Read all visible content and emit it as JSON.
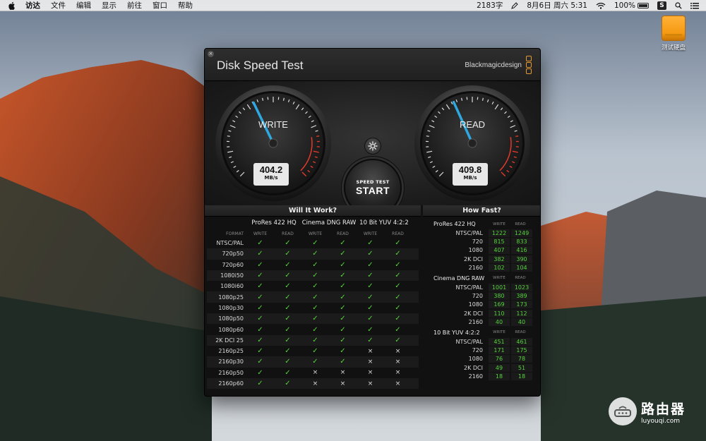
{
  "menubar": {
    "items": [
      "访达",
      "文件",
      "编辑",
      "显示",
      "前往",
      "窗口",
      "帮助"
    ],
    "word_count": "2183字",
    "datetime": "8月6日 周六  5:31",
    "battery": "100%",
    "s_badge": "S"
  },
  "desktop": {
    "disk_label": "测试硬盘"
  },
  "app": {
    "title": "Disk Speed Test",
    "brand": "Blackmagicdesign",
    "close_glyph": "×",
    "write": {
      "label": "WRITE",
      "value": "404.2",
      "unit": "MB/s",
      "level": 404.2
    },
    "read": {
      "label": "READ",
      "value": "409.8",
      "unit": "MB/s",
      "level": 409.8
    },
    "start": {
      "sub": "SPEED TEST",
      "main": "START"
    },
    "accent_color": "#2fa8e0",
    "ok_color": "#54d43a"
  },
  "will_it_work": {
    "title": "Will It Work?",
    "groups": [
      "ProRes 422 HQ",
      "Cinema DNG RAW",
      "10 Bit YUV 4:2:2"
    ],
    "format_label": "FORMAT",
    "write_label": "WRITE",
    "read_label": "READ",
    "check": "✓",
    "cross": "×",
    "rows": [
      {
        "fmt": "NTSC/PAL",
        "v": [
          1,
          1,
          1,
          1,
          1,
          1
        ]
      },
      {
        "fmt": "720p50",
        "v": [
          1,
          1,
          1,
          1,
          1,
          1
        ]
      },
      {
        "fmt": "720p60",
        "v": [
          1,
          1,
          1,
          1,
          1,
          1
        ]
      },
      {
        "fmt": "1080i50",
        "v": [
          1,
          1,
          1,
          1,
          1,
          1
        ]
      },
      {
        "fmt": "1080i60",
        "v": [
          1,
          1,
          1,
          1,
          1,
          1
        ]
      },
      {
        "fmt": "1080p25",
        "v": [
          1,
          1,
          1,
          1,
          1,
          1
        ]
      },
      {
        "fmt": "1080p30",
        "v": [
          1,
          1,
          1,
          1,
          1,
          1
        ]
      },
      {
        "fmt": "1080p50",
        "v": [
          1,
          1,
          1,
          1,
          1,
          1
        ]
      },
      {
        "fmt": "1080p60",
        "v": [
          1,
          1,
          1,
          1,
          1,
          1
        ]
      },
      {
        "fmt": "2K DCI 25",
        "v": [
          1,
          1,
          1,
          1,
          1,
          1
        ]
      },
      {
        "fmt": "2160p25",
        "v": [
          1,
          1,
          1,
          1,
          0,
          0
        ]
      },
      {
        "fmt": "2160p30",
        "v": [
          1,
          1,
          1,
          1,
          0,
          0
        ]
      },
      {
        "fmt": "2160p50",
        "v": [
          1,
          1,
          0,
          0,
          0,
          0
        ]
      },
      {
        "fmt": "2160p60",
        "v": [
          1,
          1,
          0,
          0,
          0,
          0
        ]
      }
    ]
  },
  "how_fast": {
    "title": "How Fast?",
    "write_label": "WRITE",
    "read_label": "READ",
    "groups": [
      {
        "name": "ProRes 422 HQ",
        "rows": [
          {
            "fmt": "NTSC/PAL",
            "w": "1222",
            "r": "1249"
          },
          {
            "fmt": "720",
            "w": "815",
            "r": "833"
          },
          {
            "fmt": "1080",
            "w": "407",
            "r": "416"
          },
          {
            "fmt": "2K DCI",
            "w": "382",
            "r": "390"
          },
          {
            "fmt": "2160",
            "w": "102",
            "r": "104"
          }
        ]
      },
      {
        "name": "Cinema DNG RAW",
        "rows": [
          {
            "fmt": "NTSC/PAL",
            "w": "1001",
            "r": "1023"
          },
          {
            "fmt": "720",
            "w": "380",
            "r": "389"
          },
          {
            "fmt": "1080",
            "w": "169",
            "r": "173"
          },
          {
            "fmt": "2K DCI",
            "w": "110",
            "r": "112"
          },
          {
            "fmt": "2160",
            "w": "40",
            "r": "40"
          }
        ]
      },
      {
        "name": "10 Bit YUV 4:2:2",
        "rows": [
          {
            "fmt": "NTSC/PAL",
            "w": "451",
            "r": "461"
          },
          {
            "fmt": "720",
            "w": "171",
            "r": "175"
          },
          {
            "fmt": "1080",
            "w": "76",
            "r": "78"
          },
          {
            "fmt": "2K DCI",
            "w": "49",
            "r": "51"
          },
          {
            "fmt": "2160",
            "w": "18",
            "r": "18"
          }
        ]
      }
    ]
  },
  "watermark": {
    "name": "路由器",
    "url": "luyouqi.com"
  }
}
